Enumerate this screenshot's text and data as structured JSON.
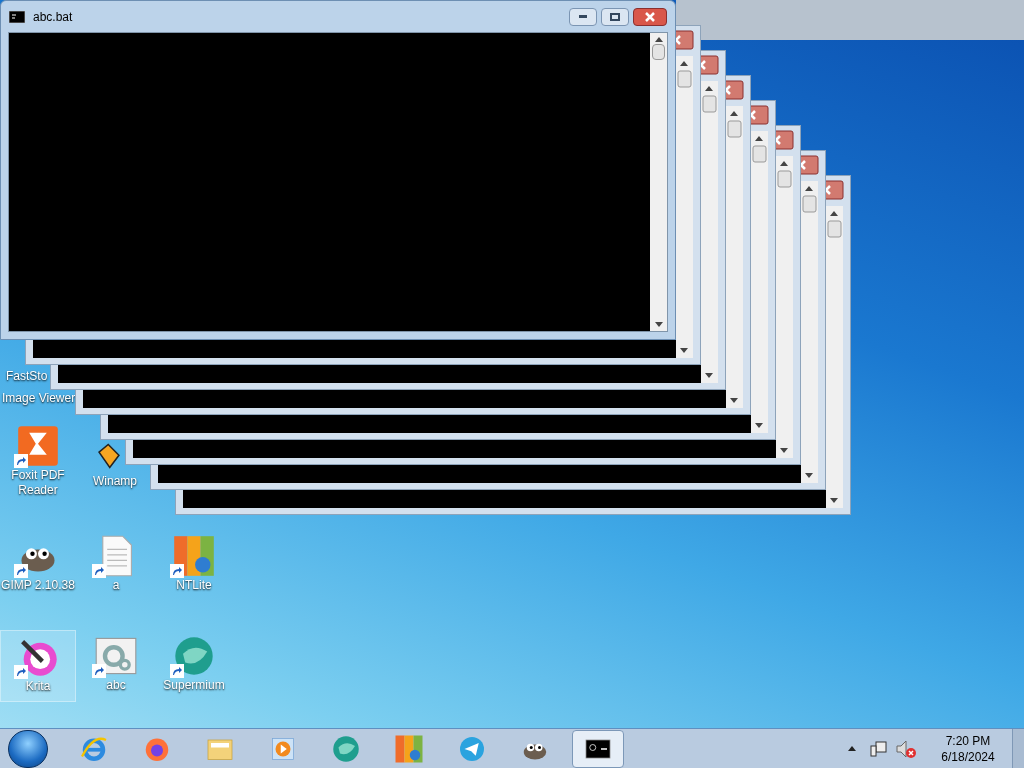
{
  "window": {
    "title": "abc.bat",
    "active": true
  },
  "desktop_icons": [
    {
      "kind": "faststone",
      "lines": [
        "FastSto",
        "Image Viewer"
      ],
      "selected": false
    },
    {
      "kind": "foxit",
      "lines": [
        "Foxit PDF",
        "Reader"
      ],
      "selected": false
    },
    {
      "kind": "winamp",
      "lines": [
        "Winamp"
      ],
      "selected": false
    },
    {
      "kind": "gimp",
      "lines": [
        "GIMP 2.10.38"
      ],
      "selected": false
    },
    {
      "kind": "text",
      "lines": [
        "a"
      ],
      "selected": false
    },
    {
      "kind": "ntlite",
      "lines": [
        "NTLite"
      ],
      "selected": false
    },
    {
      "kind": "krita",
      "lines": [
        "Krita"
      ],
      "selected": true
    },
    {
      "kind": "settings",
      "lines": [
        "abc"
      ],
      "selected": false
    },
    {
      "kind": "supermium",
      "lines": [
        "Supermium"
      ],
      "selected": false
    }
  ],
  "taskbar": {
    "items": [
      {
        "kind": "ie",
        "selected": false
      },
      {
        "kind": "firefox",
        "selected": false
      },
      {
        "kind": "explorer",
        "selected": false
      },
      {
        "kind": "media",
        "selected": false
      },
      {
        "kind": "supermium",
        "selected": false
      },
      {
        "kind": "ntlite",
        "selected": false
      },
      {
        "kind": "telegram",
        "selected": false
      },
      {
        "kind": "gimp",
        "selected": false
      },
      {
        "kind": "cmd",
        "selected": true
      }
    ],
    "tray": {
      "time": "7:20 PM",
      "date": "6/18/2024",
      "muted": true
    }
  }
}
